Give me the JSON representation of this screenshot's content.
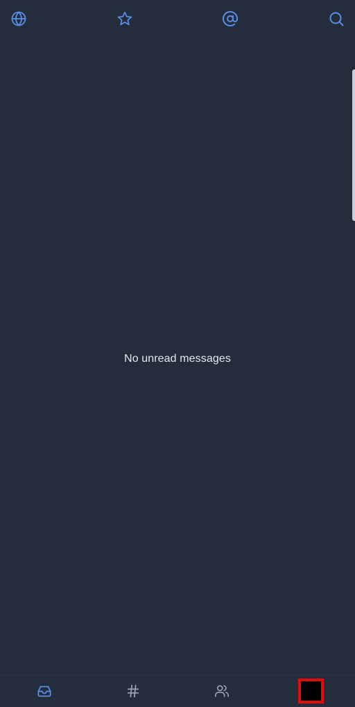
{
  "top_nav": {
    "items": [
      {
        "id": "all",
        "icon": "globe-icon"
      },
      {
        "id": "starred",
        "icon": "star-icon"
      },
      {
        "id": "mentions",
        "icon": "at-sign-icon"
      },
      {
        "id": "search",
        "icon": "search-icon"
      }
    ]
  },
  "main": {
    "empty_message": "No unread messages"
  },
  "bottom_nav": {
    "tabs": [
      {
        "id": "inbox",
        "icon": "inbox-icon",
        "active": true
      },
      {
        "id": "streams",
        "icon": "hash-icon",
        "active": false
      },
      {
        "id": "people",
        "icon": "people-icon",
        "active": false
      },
      {
        "id": "profile",
        "icon": "avatar",
        "active": false
      }
    ]
  },
  "colors": {
    "background": "#232d3b",
    "accent": "#5b8ee8",
    "inactive_icon": "#9aa4b3",
    "text": "#e6e9ee",
    "highlight_outline": "#e30b0b"
  }
}
